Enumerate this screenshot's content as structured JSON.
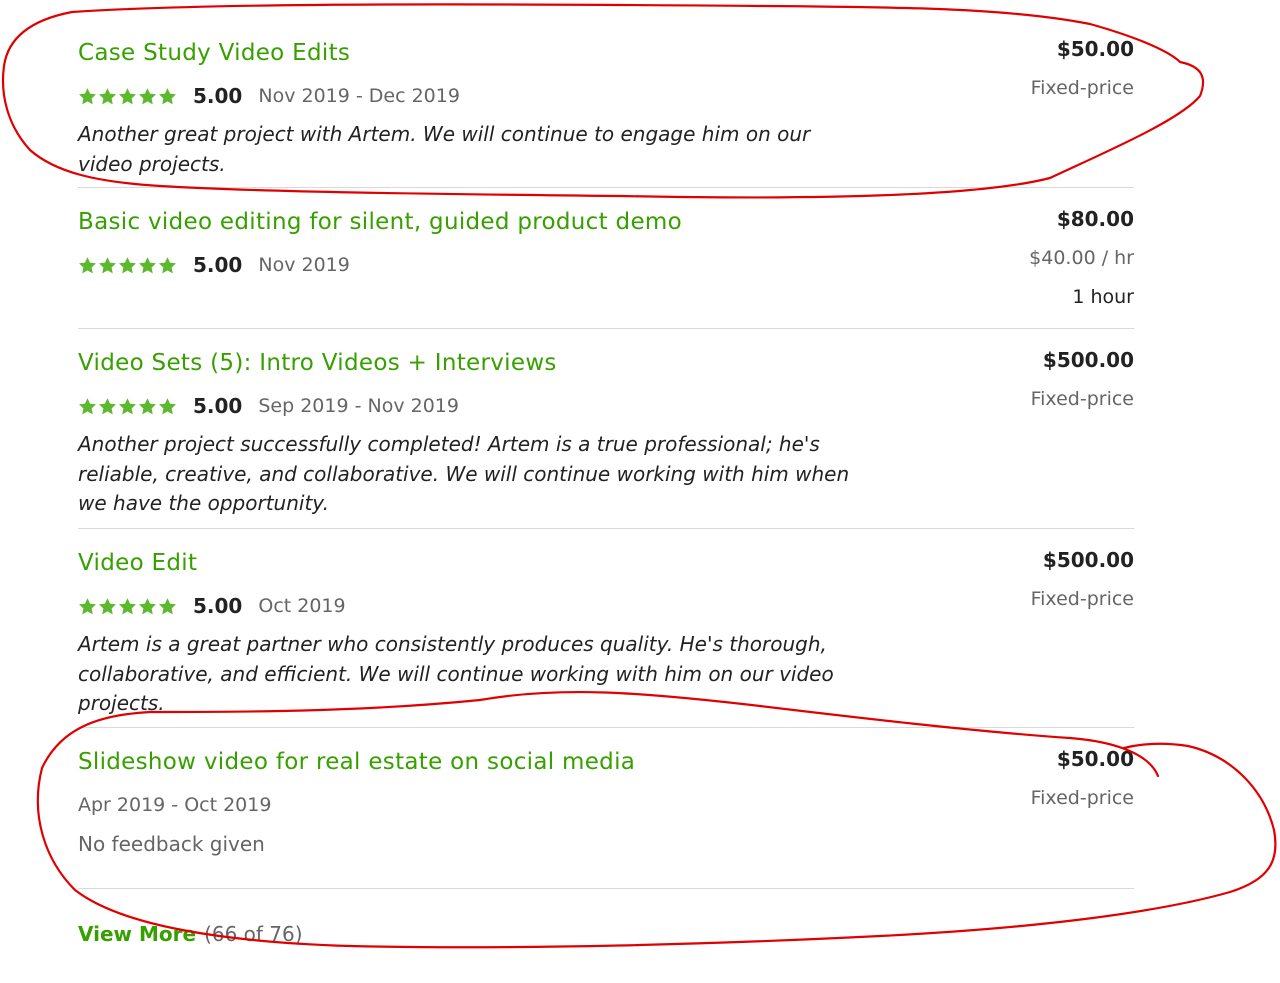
{
  "jobs": [
    {
      "title": "Case Study Video Edits",
      "score": "5.00",
      "dates": "Nov 2019 - Dec 2019",
      "feedback": "Another great project with Artem. We will continue to engage him on our video projects.",
      "amount": "$50.00",
      "type": "Fixed-price"
    },
    {
      "title": "Basic video editing for silent, guided product demo",
      "score": "5.00",
      "dates": "Nov 2019",
      "amount": "$80.00",
      "rate": "$40.00 / hr",
      "hours": "1 hour"
    },
    {
      "title": "Video Sets (5): Intro Videos + Interviews",
      "score": "5.00",
      "dates": "Sep 2019 - Nov 2019",
      "feedback": "Another project successfully completed! Artem is a true professional; he's reliable, creative, and collaborative. We will continue working with him when we have the opportunity.",
      "amount": "$500.00",
      "type": "Fixed-price"
    },
    {
      "title": "Video Edit",
      "score": "5.00",
      "dates": "Oct 2019",
      "feedback": "Artem is a great partner who consistently produces quality. He's thorough, collaborative, and efficient. We will continue working with him on our video projects.",
      "amount": "$500.00",
      "type": "Fixed-price"
    },
    {
      "title": "Slideshow video for real estate on social media",
      "dates": "Apr 2019 - Oct 2019",
      "no_feedback": "No feedback given",
      "amount": "$50.00",
      "type": "Fixed-price"
    }
  ],
  "view_more": {
    "label": "View More",
    "count": "(66 of 76)"
  },
  "colors": {
    "brand_green": "#37a000",
    "star_green": "#5cb82c",
    "annotation_red": "#e00000"
  },
  "icons": {
    "star": "star-icon"
  }
}
